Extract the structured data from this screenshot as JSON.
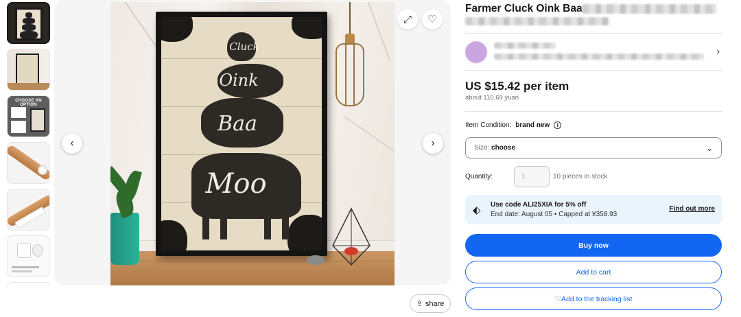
{
  "thumbnails": [
    {
      "name": "poster-front"
    },
    {
      "name": "poster-room"
    },
    {
      "name": "choose-option",
      "label": "CHOOSE AN OPTION"
    },
    {
      "name": "paper-tube"
    },
    {
      "name": "paper-roll"
    },
    {
      "name": "mug-info"
    }
  ],
  "main_image": {
    "words": [
      "Cluck",
      "Oink",
      "Baa",
      "Moo"
    ],
    "prev_icon": "chevron-left-icon",
    "next_icon": "chevron-right-icon"
  },
  "actions": {
    "share_label": "share"
  },
  "product": {
    "title": "Farmer Cluck Oink Baa",
    "price": "US $15.42 per item",
    "price_converted": "about 110.69 yuan",
    "condition_label": "Item Condition:",
    "condition_value": "brand new",
    "size_label": "Size:",
    "size_value": "choose",
    "quantity_label": "Quantity:",
    "quantity_value": "1",
    "stock_text": "10 pieces in stock"
  },
  "coupon": {
    "line1": "Use code ALI25XIA for 5% off",
    "line2": "End date: August 05 • Capped at ¥358.93",
    "link": "Find out more"
  },
  "buttons": {
    "buy_now": "Buy now",
    "add_to_cart": "Add to cart",
    "tracking": "♡Add to the tracking list"
  },
  "colors": {
    "primary": "#1266f1",
    "coupon_bg": "#eaf4fc",
    "text": "#191919",
    "muted": "#707070"
  }
}
